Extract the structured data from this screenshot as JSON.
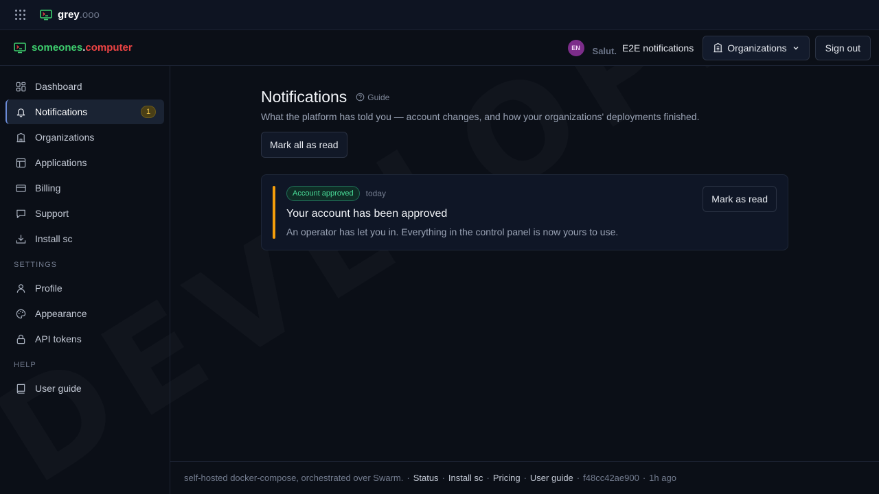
{
  "watermark": "DEVELOPMENT",
  "topbar": {
    "brand_name": "grey",
    "brand_ext": ".ooo"
  },
  "subbar": {
    "brand_a": "someones",
    "brand_dot": ".",
    "brand_b": "computer",
    "avatar_initials": "EN",
    "greeting": "Salut.",
    "org_name": "E2E notifications",
    "org_button": "Organizations",
    "signout_button": "Sign out"
  },
  "sidebar": {
    "items": [
      {
        "label": "Dashboard"
      },
      {
        "label": "Notifications",
        "badge": "1"
      },
      {
        "label": "Organizations"
      },
      {
        "label": "Applications"
      },
      {
        "label": "Billing"
      },
      {
        "label": "Support"
      },
      {
        "label": "Install sc"
      }
    ],
    "settings_label": "SETTINGS",
    "settings_items": [
      {
        "label": "Profile"
      },
      {
        "label": "Appearance"
      },
      {
        "label": "API tokens"
      }
    ],
    "help_label": "HELP",
    "help_items": [
      {
        "label": "User guide"
      }
    ]
  },
  "main": {
    "title": "Notifications",
    "guide_label": "Guide",
    "subtitle": "What the platform has told you — account changes, and how your organizations' deployments finished.",
    "mark_all_label": "Mark all as read",
    "notifications": [
      {
        "tag": "Account approved",
        "time": "today",
        "title": "Your account has been approved",
        "body": "An operator has let you in. Everything in the control panel is now yours to use.",
        "mark_read_label": "Mark as read"
      }
    ]
  },
  "footer": {
    "text": "self-hosted docker-compose, orchestrated over Swarm.",
    "links": [
      "Status",
      "Install sc",
      "Pricing",
      "User guide"
    ],
    "commit": "f48cc42ae900",
    "age": "1h ago"
  },
  "colors": {
    "accent_green": "#3ecf6e",
    "accent_red": "#ef4444",
    "unread_bar": "#f59e0b",
    "badge": "#f0c34a"
  }
}
